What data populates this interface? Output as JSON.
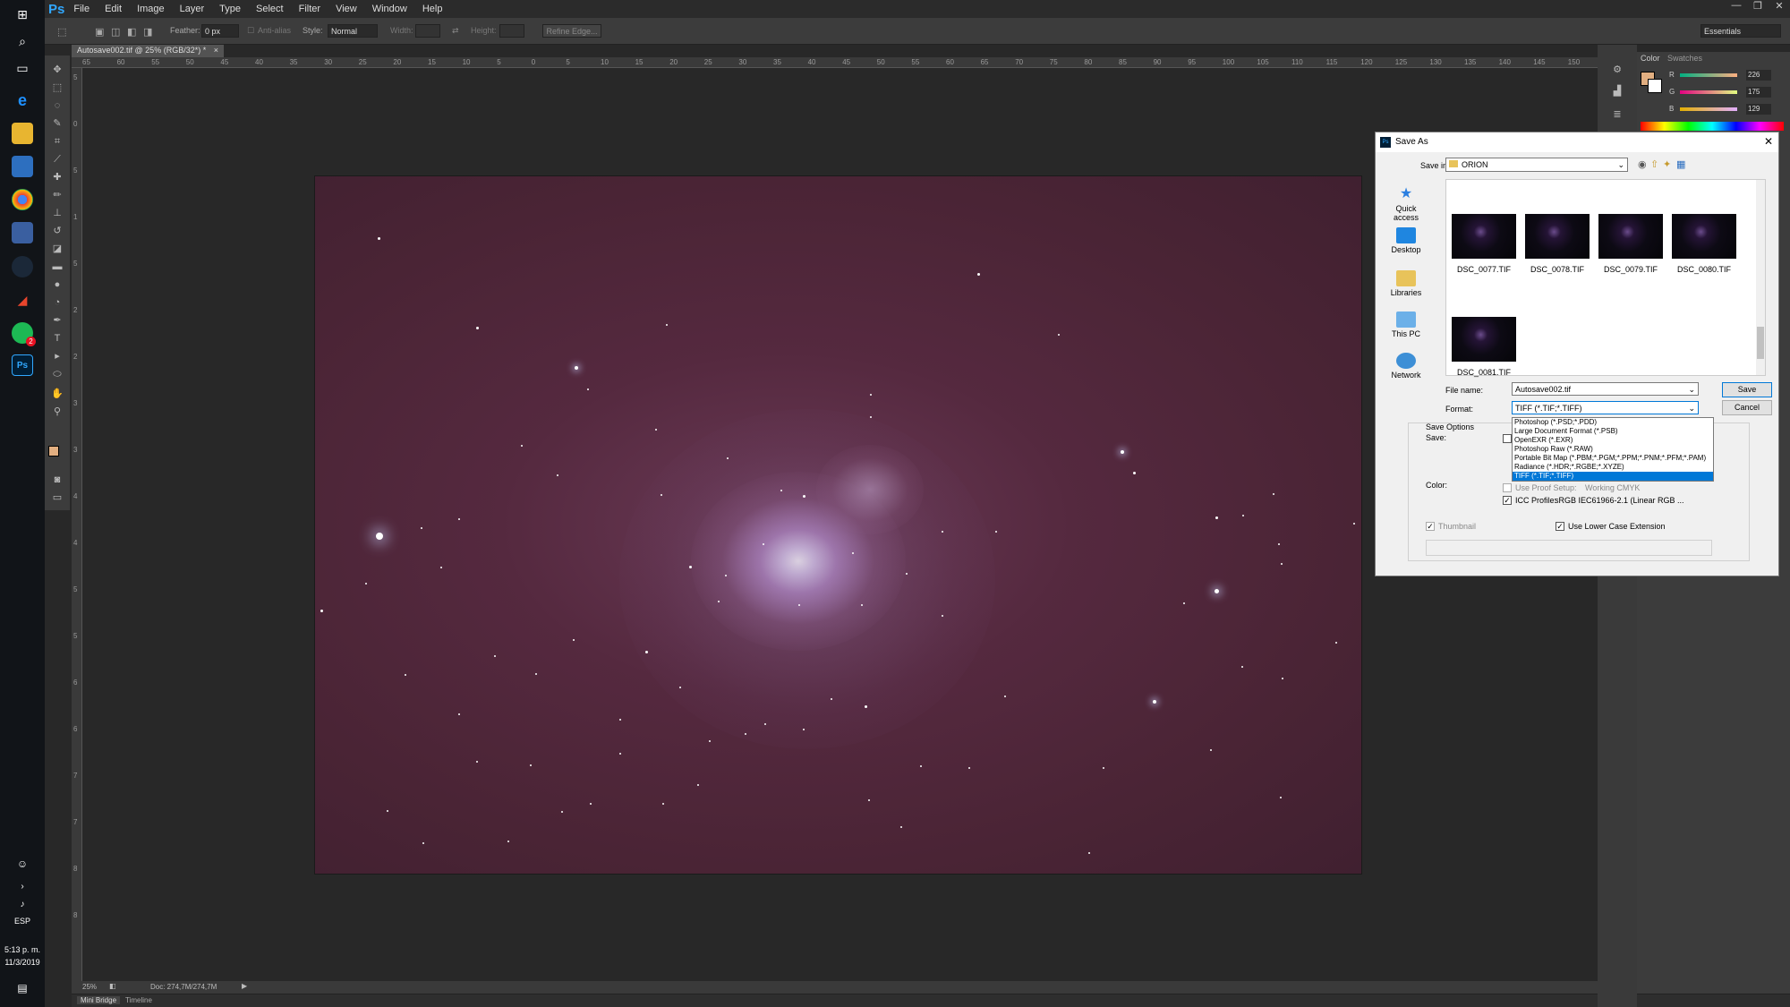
{
  "taskbar": {
    "time": "5:13 p. m.",
    "date": "11/3/2019",
    "lang": "ESP",
    "notification_badge": "2"
  },
  "menubar": {
    "logo": "Ps",
    "items": [
      "File",
      "Edit",
      "Image",
      "Layer",
      "Type",
      "Select",
      "Filter",
      "View",
      "Window",
      "Help"
    ]
  },
  "options": {
    "feather_label": "Feather:",
    "feather_value": "0 px",
    "antialias_label": "Anti-alias",
    "style_label": "Style:",
    "style_value": "Normal",
    "width_label": "Width:",
    "height_label": "Height:",
    "refine_edge": "Refine Edge...",
    "workspace": "Essentials"
  },
  "document": {
    "tab_title": "Autosave002.tif @ 25% (RGB/32*) *",
    "zoom": "25%",
    "doc_size": "Doc: 274,7M/274,7M"
  },
  "ruler": {
    "h_ticks": [
      "65",
      "60",
      "55",
      "50",
      "45",
      "40",
      "35",
      "30",
      "25",
      "20",
      "15",
      "10",
      "5",
      "0",
      "5",
      "10",
      "15",
      "20",
      "25",
      "30",
      "35",
      "40",
      "45",
      "50",
      "55",
      "60",
      "65",
      "70",
      "75",
      "80",
      "85",
      "90",
      "95",
      "100",
      "105",
      "110",
      "115",
      "120",
      "125",
      "130",
      "135",
      "140",
      "145",
      "150",
      "155",
      "160",
      "165",
      "170",
      "175",
      "180"
    ],
    "v_ticks": [
      "5",
      "0",
      "5",
      "1",
      "5",
      "2",
      "2",
      "3",
      "3",
      "4",
      "4",
      "5",
      "5",
      "6",
      "6",
      "7",
      "7",
      "8",
      "8"
    ]
  },
  "bottom_tabs": [
    "Mini Bridge",
    "Timeline"
  ],
  "color_panel": {
    "tabs": [
      "Color",
      "Swatches"
    ],
    "channels": [
      {
        "name": "R",
        "value": "226"
      },
      {
        "name": "G",
        "value": "175"
      },
      {
        "name": "B",
        "value": "129"
      }
    ],
    "foreground": "#e2af81"
  },
  "dialog": {
    "title": "Save As",
    "save_in_label": "Save in:",
    "save_in_value": "ORION",
    "nav": [
      "Quick access",
      "Desktop",
      "Libraries",
      "This PC",
      "Network"
    ],
    "files": [
      "DSC_0077.TIF",
      "DSC_0078.TIF",
      "DSC_0079.TIF",
      "DSC_0080.TIF",
      "DSC_0081.TIF"
    ],
    "filename_label": "File name:",
    "filename_value": "Autosave002.tif",
    "format_label": "Format:",
    "format_value": "TIFF (*.TIF;*.TIFF)",
    "save_button": "Save",
    "cancel_button": "Cancel",
    "format_options": [
      "Photoshop (*.PSD;*.PDD)",
      "Large Document Format (*.PSB)",
      "OpenEXR (*.EXR)",
      "Photoshop Raw (*.RAW)",
      "Portable Bit Map (*.PBM;*.PGM;*.PPM;*.PNM;*.PFM;*.PAM)",
      "Radiance (*.HDR;*.RGBE;*.XYZE)",
      "TIFF (*.TIF;*.TIFF)"
    ],
    "save_options_label": "Save Options",
    "save_label": "Save:",
    "color_label": "Color:",
    "use_proof_setup": "Use Proof Setup:",
    "working_cmyk": "Working CMYK",
    "icc_profile": "ICC Profile:",
    "icc_value": "sRGB IEC61966-2.1 (Linear RGB ...",
    "thumbnail": "Thumbnail",
    "lower_case": "Use Lower Case Extension"
  }
}
